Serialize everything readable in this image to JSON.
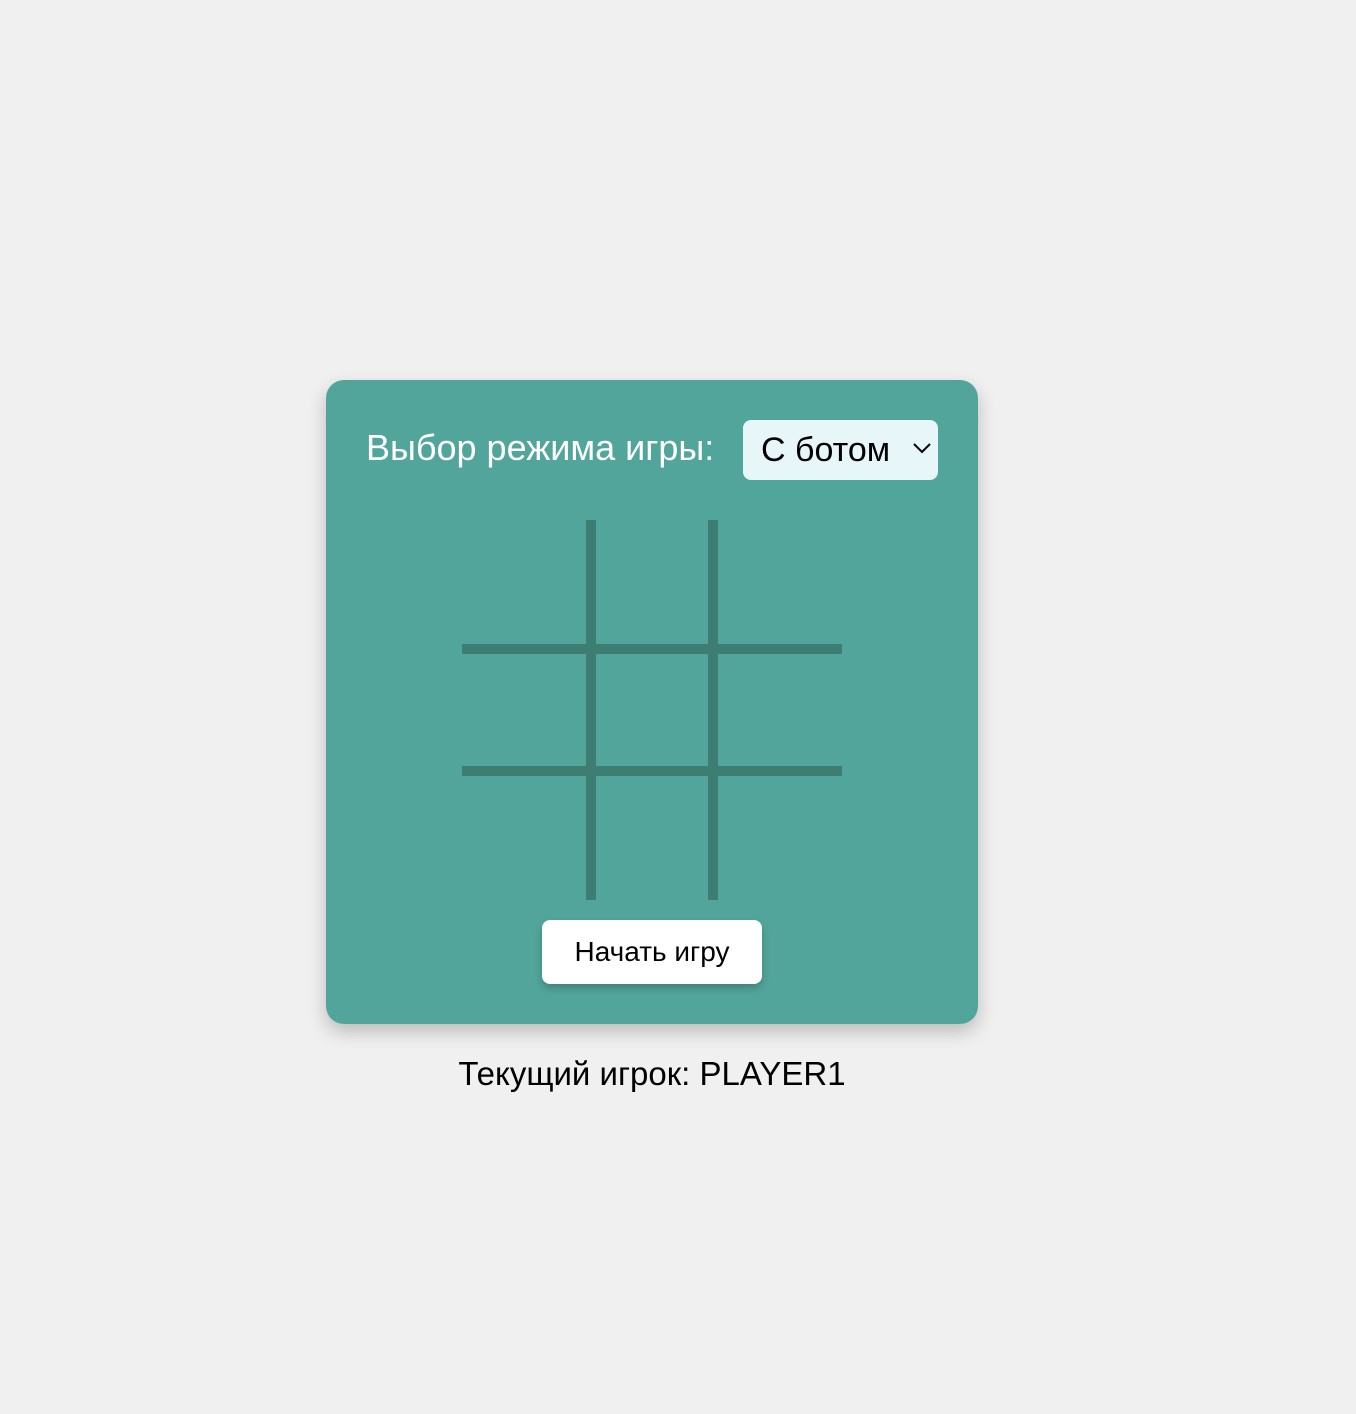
{
  "colors": {
    "page_background": "#f0f0f0",
    "card_background": "#52a59b",
    "grid_lines": "#3d7d72",
    "select_background": "#e6f6f9",
    "button_background": "#ffffff"
  },
  "mode": {
    "label": "Выбор режима игры:",
    "selected": "С ботом"
  },
  "board": {
    "rows": 3,
    "cols": 3,
    "cells": [
      "",
      "",
      "",
      "",
      "",
      "",
      "",
      "",
      ""
    ]
  },
  "start_button": {
    "label": "Начать игру"
  },
  "status": {
    "text": "Текущий игрок: PLAYER1"
  },
  "icons": {
    "select_arrow": "chevron-down-icon"
  }
}
